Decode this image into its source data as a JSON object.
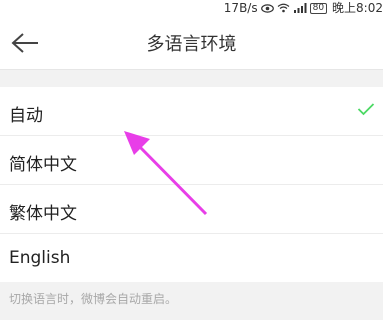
{
  "status_bar": {
    "speed": "17B/s",
    "battery_level": "80",
    "time": "晚上8:02"
  },
  "header": {
    "title": "多语言环境"
  },
  "language_options": {
    "items": [
      {
        "label": "自动",
        "selected": true
      },
      {
        "label": "简体中文",
        "selected": false
      },
      {
        "label": "繁体中文",
        "selected": false
      },
      {
        "label": "English",
        "selected": false
      }
    ]
  },
  "hint": "切换语言时，微博会自动重启。",
  "colors": {
    "check": "#4cd964",
    "annotation": "#e83ee8"
  }
}
